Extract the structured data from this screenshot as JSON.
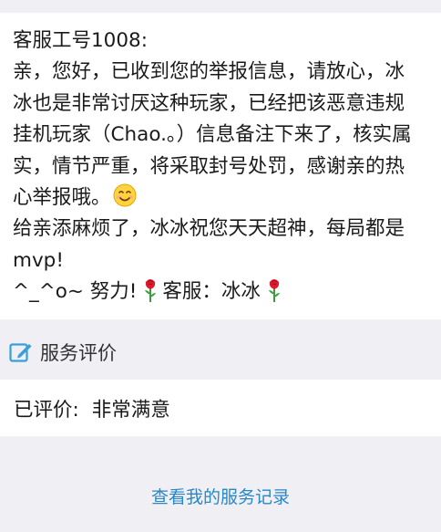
{
  "message": {
    "lines": [
      "客服工号1008:",
      "亲，您好，已收到您的举报信息，请放心，冰",
      "冰也是非常讨厌这种玩家，已经把该恶意违规",
      "挂机玩家（Chao.。）信息备注下来了，核实属",
      "实，情节严重，将采取封号处罚，感谢亲的热",
      "心举报哦。",
      "给亲添麻烦了，冰冰祝您天天超神，每局都是",
      "mvp!"
    ],
    "signoff_prefix": "^_^o~ 努力!",
    "signoff_agent": "客服：冰冰",
    "icons": [
      "smile-emoji",
      "rose-emoji"
    ]
  },
  "evaluation": {
    "header_label": "服务评价",
    "header_icon": "edit-icon",
    "result_label": "已评价:",
    "result_value": "非常满意"
  },
  "footer": {
    "records_link": "查看我的服务记录"
  },
  "colors": {
    "background": "#efeff4",
    "card": "#ffffff",
    "link": "#2a87c6",
    "icon_blue": "#3b9ed9"
  }
}
